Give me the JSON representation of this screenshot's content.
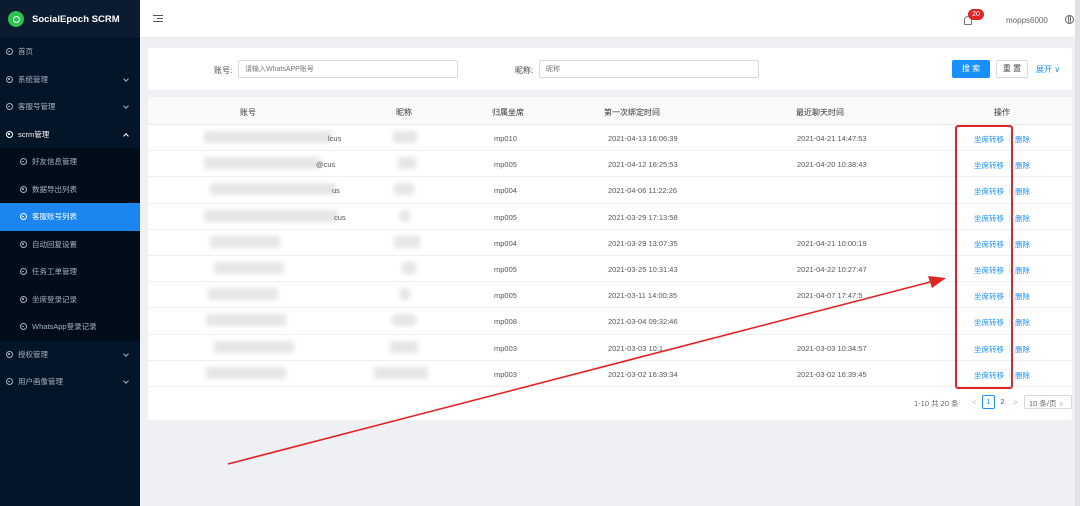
{
  "brand": {
    "title": "SocialEpoch SCRM"
  },
  "sidebar": {
    "items": [
      {
        "label": "首页",
        "type": "top",
        "chevron": false
      },
      {
        "label": "系统管理",
        "type": "top",
        "chevron": true
      },
      {
        "label": "客服号管理",
        "type": "top",
        "chevron": true
      },
      {
        "label": "scrm管理",
        "type": "top-open",
        "chevron": true
      },
      {
        "label": "好友信息管理",
        "type": "sub"
      },
      {
        "label": "数据导出列表",
        "type": "sub"
      },
      {
        "label": "客服账号列表",
        "type": "sub-active"
      },
      {
        "label": "自动回复设置",
        "type": "sub"
      },
      {
        "label": "任务工单管理",
        "type": "sub"
      },
      {
        "label": "坐席登录记录",
        "type": "sub"
      },
      {
        "label": "WhatsApp登录记录",
        "type": "sub"
      },
      {
        "label": "授权管理",
        "type": "top",
        "chevron": true
      },
      {
        "label": "用户画像管理",
        "type": "top",
        "chevron": true
      }
    ]
  },
  "header": {
    "notification_count": "20",
    "username": "mopps6000"
  },
  "search": {
    "account_label": "账号:",
    "account_placeholder": "请输入WhatsAPP账号",
    "nickname_label": "昵称:",
    "nickname_placeholder": "昵称",
    "search_button": "搜 索",
    "reset_button": "重 置",
    "expand_link": "展开"
  },
  "table": {
    "headers": [
      "账号",
      "昵称",
      "归属坐席",
      "第一次绑定时间",
      "最近聊天时间",
      "操作"
    ],
    "rows": [
      {
        "account_suffix": "lcus",
        "seat": "mp010",
        "first_bind": "2021-04-13 16:06:39",
        "last_chat": "2021-04-21 14:47:53"
      },
      {
        "account_suffix": "@cus",
        "seat": "mp005",
        "first_bind": "2021-04-12 16:25:53",
        "last_chat": "2021-04-20 10:38:43"
      },
      {
        "account_suffix": "us",
        "seat": "mp004",
        "first_bind": "2021-04-06 11:22:26",
        "last_chat": ""
      },
      {
        "account_suffix": "cus",
        "seat": "mp005",
        "first_bind": "2021-03-29 17:13:58",
        "last_chat": ""
      },
      {
        "account_suffix": "",
        "seat": "mp004",
        "first_bind": "2021-03-29 13:07:35",
        "last_chat": "2021-04-21 10:00:19"
      },
      {
        "account_suffix": "",
        "seat": "mp005",
        "first_bind": "2021-03-25 10:31:43",
        "last_chat": "2021-04-22 10:27:47"
      },
      {
        "account_suffix": "",
        "seat": "mp005",
        "first_bind": "2021-03-11 14:00:35",
        "last_chat": "2021-04-07 17:47:5"
      },
      {
        "account_suffix": "",
        "seat": "mp008",
        "first_bind": "2021-03-04 09:32:46",
        "last_chat": ""
      },
      {
        "account_suffix": "",
        "seat": "mp003",
        "first_bind": "2021-03-03 10:1",
        "last_chat": "2021-03-03 10:34:57"
      },
      {
        "account_suffix": "",
        "seat": "mp003",
        "first_bind": "2021-03-02 16:39:34",
        "last_chat": "2021-03-02 16:39:45"
      }
    ],
    "action_transfer": "坐席转移",
    "action_delete": "删除"
  },
  "pagination": {
    "total_text": "1-10 共 20 条",
    "prev": "<",
    "next": ">",
    "pages": [
      "1",
      "2"
    ],
    "current_page": 1,
    "page_size": "10 条/页"
  },
  "colors": {
    "primary": "#1890ff",
    "sidebar_bg": "#041527",
    "highlight": "#e02525",
    "logo": "#2ec24f"
  }
}
